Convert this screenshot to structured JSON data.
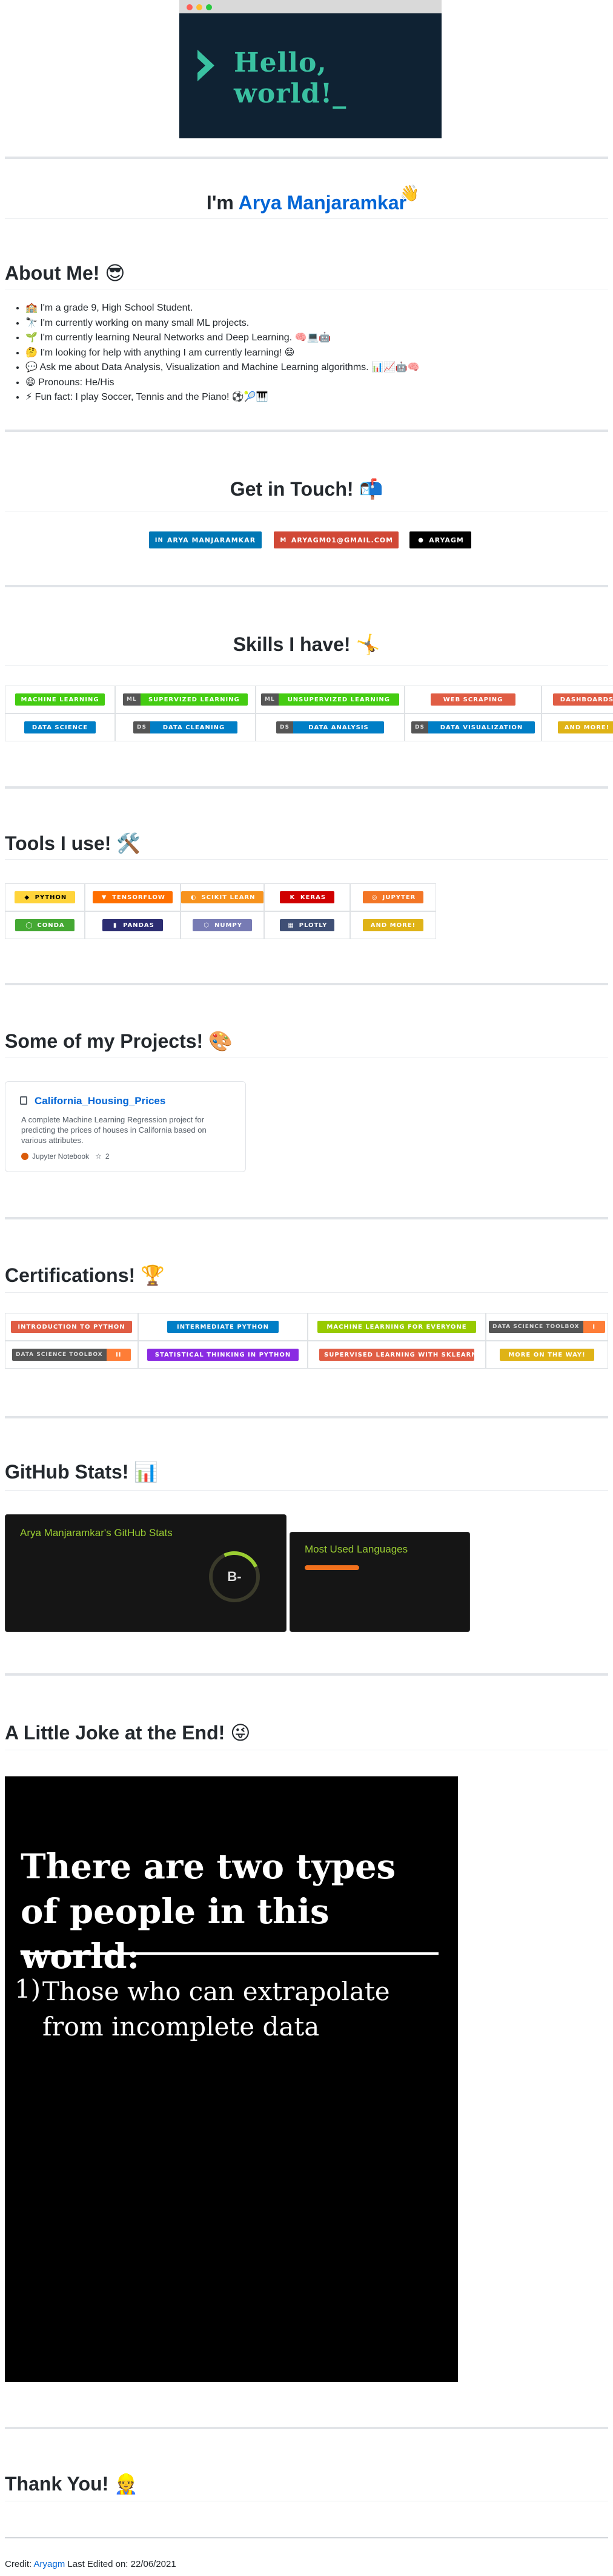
{
  "banner": {
    "text": "Hello, world!_"
  },
  "intro": {
    "prefix": "I'm ",
    "name": "Arya Manjaramkar",
    "wave": "👋"
  },
  "about": {
    "title": "About Me! 😎",
    "items": [
      "🏫 I'm a grade 9, High School Student.",
      "🔭 I'm currently working on many small ML projects.",
      "🌱 I'm currently learning Neural Networks and Deep Learning. 🧠💻🤖",
      "🤔 I'm looking for help with anything I am currently learning! 😄",
      "💬 Ask me about Data Analysis, Visualization and Machine Learning algorithms. 📊📈🤖🧠",
      "😄 Pronouns: He/His",
      "⚡ Fun fact: I play Soccer, Tennis and the Piano! ⚽🎾🎹"
    ]
  },
  "contact": {
    "title": "Get in Touch! 📬",
    "badges": [
      {
        "label": "ARYA MANJARAMKAR",
        "icon": "linkedin-icon",
        "glyph": "in",
        "color": "#0077b5"
      },
      {
        "label": "ARYAGM01@GMAIL.COM",
        "icon": "gmail-icon",
        "glyph": "M",
        "color": "#d14836"
      },
      {
        "label": "ARYAGM",
        "icon": "github-icon",
        "glyph": "●",
        "color": "#000000"
      }
    ]
  },
  "skills": {
    "title": "Skills I have! 🤸",
    "row1": [
      {
        "left": "",
        "label": "MACHINE LEARNING",
        "color": "#4c1"
      },
      {
        "left": "ML",
        "label": "SUPERVIZED LEARNING",
        "color": "#4c1"
      },
      {
        "left": "ML",
        "label": "UNSUPERVIZED LEARNING",
        "color": "#4c1"
      },
      {
        "left": "",
        "label": "WEB SCRAPING",
        "color": "#e05d44"
      },
      {
        "left": "",
        "label": "DASHBOARDS",
        "color": "#e05d44"
      }
    ],
    "row2": [
      {
        "left": "",
        "label": "DATA SCIENCE",
        "color": "#007ec6"
      },
      {
        "left": "DS",
        "label": "DATA CLEANING",
        "color": "#007ec6"
      },
      {
        "left": "DS",
        "label": "DATA ANALYSIS",
        "color": "#007ec6"
      },
      {
        "left": "DS",
        "label": "DATA VISUALIZATION",
        "color": "#007ec6"
      },
      {
        "left": "",
        "label": "AND MORE!",
        "color": "#dfb317"
      }
    ]
  },
  "tools": {
    "title": "Tools I use! 🛠️",
    "row1": [
      {
        "label": "PYTHON",
        "color": "#ffd43b",
        "text": "#000000",
        "icon": "python-icon",
        "glyph": "◆"
      },
      {
        "label": "TENSORFLOW",
        "color": "#ff6f00",
        "text": "#ffffff",
        "icon": "tensorflow-icon",
        "glyph": "▼"
      },
      {
        "label": "SCIKIT LEARN",
        "color": "#f7931e",
        "text": "#ffffff",
        "icon": "scikit-learn-icon",
        "glyph": "◐"
      },
      {
        "label": "KERAS",
        "color": "#d00000",
        "text": "#ffffff",
        "icon": "keras-icon",
        "glyph": "K"
      },
      {
        "label": "JUPYTER",
        "color": "#f37626",
        "text": "#ffffff",
        "icon": "jupyter-icon",
        "glyph": "◎"
      }
    ],
    "row2": [
      {
        "label": "CONDA",
        "color": "#44a833",
        "text": "#ffffff",
        "icon": "conda-icon",
        "glyph": "◯"
      },
      {
        "label": "PANDAS",
        "color": "#2c2d72",
        "text": "#ffffff",
        "icon": "pandas-icon",
        "glyph": "▮"
      },
      {
        "label": "NUMPY",
        "color": "#777bb4",
        "text": "#ffffff",
        "icon": "numpy-icon",
        "glyph": "⬡"
      },
      {
        "label": "PLOTLY",
        "color": "#3f4f75",
        "text": "#ffffff",
        "icon": "plotly-icon",
        "glyph": "▦"
      },
      {
        "label": "AND MORE!",
        "color": "#dfb317",
        "text": "#ffffff",
        "icon": "",
        "glyph": ""
      }
    ]
  },
  "projects": {
    "title": "Some of my Projects! 🎨",
    "card": {
      "name": "California_Housing_Prices",
      "description": "A complete Machine Learning Regression project for predicting the prices of houses in California based on various attributes.",
      "language": "Jupyter Notebook",
      "stars": "2"
    }
  },
  "certs": {
    "title": "Certifications! 🏆",
    "row1": [
      {
        "left": "",
        "label": "INTRODUCTION TO PYTHON",
        "color": "#e05d44"
      },
      {
        "left": "",
        "label": "INTERMEDIATE PYTHON",
        "color": "#007ec6"
      },
      {
        "left": "",
        "label": "MACHINE LEARNING FOR EVERYONE",
        "color": "#97ca00"
      },
      {
        "left": "DATA SCIENCE TOOLBOX",
        "label": "I",
        "color": "#fe7d37"
      }
    ],
    "row2": [
      {
        "left": "DATA SCIENCE TOOLBOX",
        "label": "II",
        "color": "#fe7d37"
      },
      {
        "left": "",
        "label": "STATISTICAL THINKING IN PYTHON",
        "color": "#8a2be2"
      },
      {
        "left": "",
        "label": "SUPERVISED LEARNING WITH SKLEARN",
        "color": "#e05d44"
      },
      {
        "left": "",
        "label": "MORE ON THE WAY!",
        "color": "#dfb317"
      }
    ]
  },
  "stats": {
    "title": "GitHub Stats! 📊",
    "card_title": "Arya Manjaramkar's GitHub Stats",
    "rank": "B-",
    "langs_title": "Most Used Languages"
  },
  "joke": {
    "title": "A Little Joke at the End! 😜",
    "headline": "There are two types of people in this world:",
    "number": "1)",
    "text": "Those who can extrapolate from incomplete data"
  },
  "thanks": {
    "title": "Thank You! 👷"
  },
  "credit": {
    "prefix": "Credit: ",
    "link": "Aryagm",
    "suffix": " Last Edited on: 22/06/2021"
  },
  "colors": {
    "link": "#0366d6",
    "banner_bg": "#0f2233",
    "banner_text": "#3ac1a1"
  }
}
